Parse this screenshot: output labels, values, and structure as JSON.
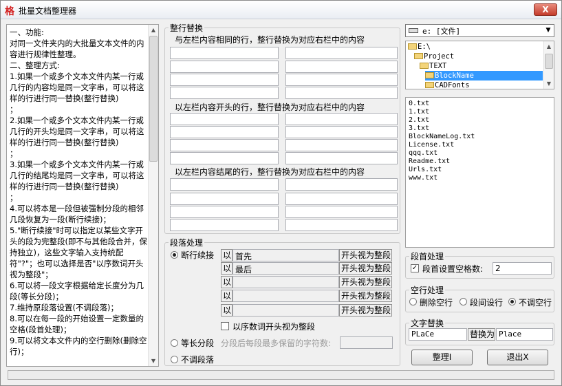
{
  "window": {
    "title": "批量文档整理器",
    "app_icon": "格",
    "close_label": "X"
  },
  "description": {
    "text": "一、功能:\n对同一文件夹内的大批量文本文件的内容进行规律性整理。\n二、整理方式:\n1.如果一个或多个文本文件内某一行或几行的内容均是同一文字串，可以将这样的行进行同一替换(整行替换)\n；\n2.如果一个或多个文本文件内某一行或几行的开头均是同一文字串，可以将这样的行进行同一替换(整行替换)\n；\n3.如果一个或多个文本文件内某一行或几行的结尾均是同一文字串，可以将这样的行进行同一替换(整行替换)\n；\n4.可以将本是一段但被强制分段的相邻几段恢复为一段(断行续接)；\n5.\"断行续接\"时可以指定以某些文字开头的段为完整段(即不与其他段合并，保持独立)，这些文字输入支持统配符\"?\"；也可以选择是否\"以序数词开头视为整段\"；\n6.可以将一段文字根据给定长度分为几段(等长分段)；\n7.维持原段落设置(不调段落)；\n8.可以在每一段的开始设置一定数量的空格(段首处理)；\n9.可以将文本文件内的空行删除(删除空行)；"
  },
  "whole_line": {
    "group_label": "整行替换",
    "same_label": "与左栏内容相同的行，整行替换为对应右栏中的内容",
    "start_label": "以左栏内容开头的行，整行替换为对应右栏中的内容",
    "end_label": "以左栏内容结尾的行，整行替换为对应右栏中的内容"
  },
  "paragraph": {
    "group_label": "段落处理",
    "options": [
      {
        "label": "断行续接",
        "selected": true
      },
      {
        "label": "等长分段",
        "selected": false
      },
      {
        "label": "不调段落",
        "selected": false
      }
    ],
    "prefix": "以",
    "suffix": "开头视为整段",
    "rows": [
      "首先",
      "最后",
      "",
      "",
      ""
    ],
    "ordinal_checkbox_label": "以序数词开头视为整段",
    "ordinal_checked": false,
    "equal_length_label": "分段后每段最多保留的字符数:",
    "equal_length_value": ""
  },
  "drive": {
    "label": "e: [文件]"
  },
  "tree": [
    {
      "label": "E:\\",
      "selected": false
    },
    {
      "label": "Project",
      "selected": false
    },
    {
      "label": "TEXT",
      "selected": false
    },
    {
      "label": "BlockName",
      "selected": true
    },
    {
      "label": "CADFonts",
      "selected": false
    }
  ],
  "files": [
    "0.txt",
    "1.txt",
    "2.txt",
    "3.txt",
    "BlockNameLog.txt",
    "License.txt",
    "qqq.txt",
    "Readme.txt",
    "Urls.txt",
    "www.txt"
  ],
  "indent": {
    "group_label": "段首处理",
    "checkbox_label": "段首设置空格数:",
    "checked": true,
    "value": "2"
  },
  "blank_lines": {
    "group_label": "空行处理",
    "options": [
      {
        "label": "删除空行",
        "selected": false
      },
      {
        "label": "段间设行",
        "selected": false
      },
      {
        "label": "不调空行",
        "selected": true
      }
    ]
  },
  "text_replace": {
    "group_label": "文字替换",
    "from": "PLaCe",
    "mid_label": "替换为",
    "to": "Place"
  },
  "buttons": {
    "organize": "整理I",
    "exit": "退出X"
  },
  "icons": {
    "app": "app-logo-icon",
    "close": "close-icon",
    "drive": "drive-icon",
    "folder": "folder-icon",
    "dropdown": "chevron-down-icon"
  }
}
